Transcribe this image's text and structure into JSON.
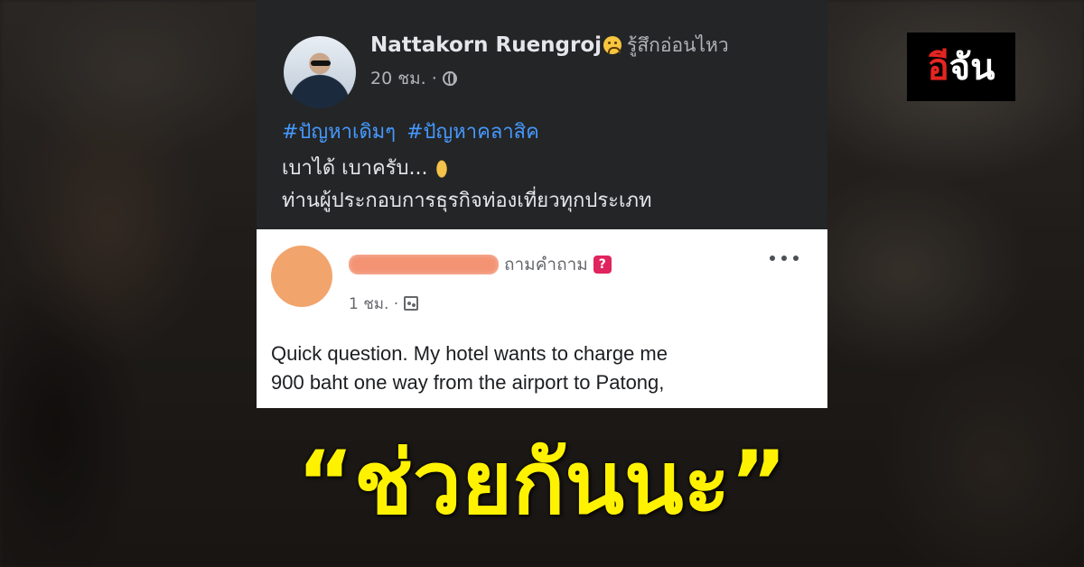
{
  "post": {
    "author": "Nattakorn Ruengroj",
    "feeling_icon": "sad-face-emoji",
    "feeling": "รู้สึกอ่อนไหว",
    "time": "20 ชม. ·",
    "privacy_icon": "globe-icon",
    "hashtags": [
      "#ปัญหาเดิมๆ",
      "#ปัญหาคลาสิค"
    ],
    "line1": "เบาได้ เบาครับ...",
    "line1_icon": "praying-hands-emoji",
    "line2": "ท่านผู้ประกอบการธุรกิจท่องเที่ยวทุกประเภท"
  },
  "comment": {
    "action": "ถามคำถาม",
    "action_icon": "question-icon",
    "time": "1 ชม. ·",
    "audience_icon": "group-icon",
    "text_line1": "Quick question.  My hotel wants to charge me",
    "text_line2": "900 baht one way from the airport to Patong,"
  },
  "logo": {
    "first": "อี",
    "rest": "จัน",
    "accent": "#e52521"
  },
  "headline": "“ช่วยกันนะ”",
  "colors": {
    "card_dark": "#242526",
    "hashtag": "#4599ff",
    "headline": "#fff200",
    "redaction": "#f28a68"
  }
}
